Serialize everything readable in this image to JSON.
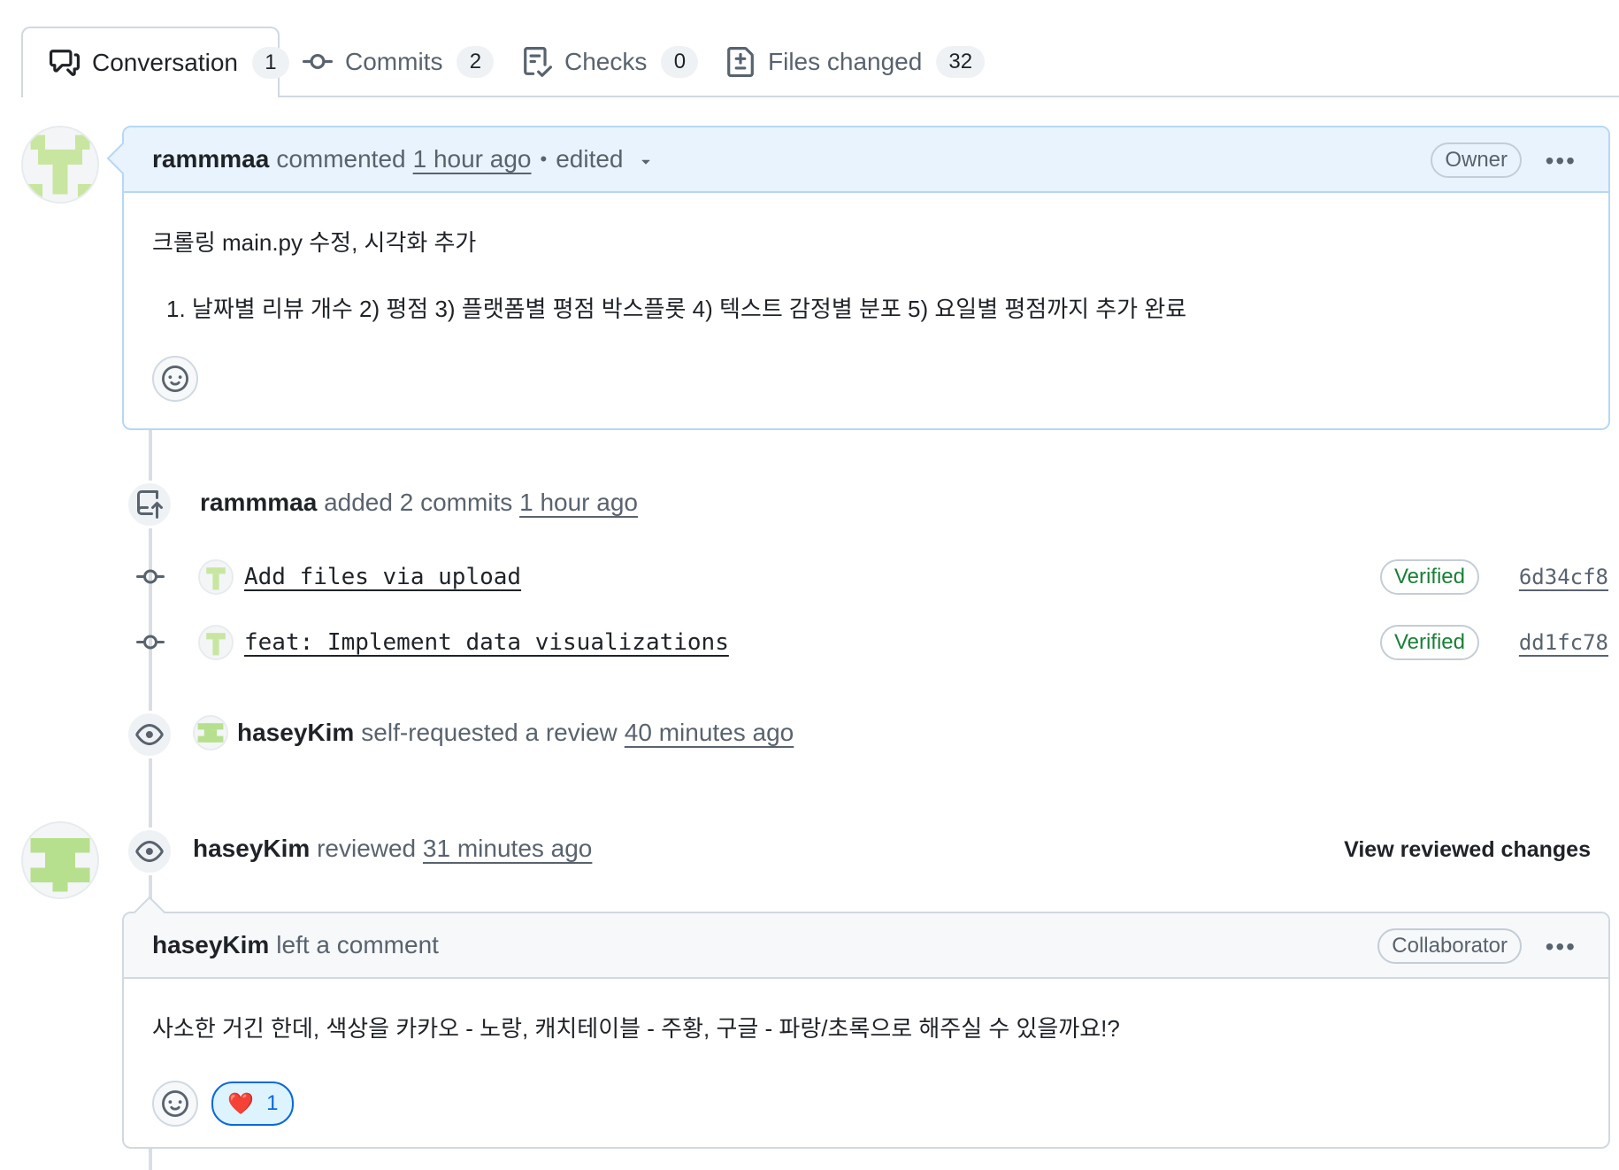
{
  "tabs": [
    {
      "label": "Conversation",
      "count": "1",
      "icon": "comment-discussion-icon",
      "selected": true
    },
    {
      "label": "Commits",
      "count": "2",
      "icon": "git-commit-icon",
      "selected": false
    },
    {
      "label": "Checks",
      "count": "0",
      "icon": "checklist-icon",
      "selected": false
    },
    {
      "label": "Files changed",
      "count": "32",
      "icon": "file-diff-icon",
      "selected": false
    }
  ],
  "comment1": {
    "author": "rammmaa",
    "action": "commented",
    "time": "1 hour ago",
    "separator": "•",
    "edited": "edited",
    "badge": "Owner",
    "menu": "•••",
    "body_line1": "크롤링 main.py 수정, 시각화 추가",
    "body_list_number": "1.",
    "body_list_item": "날짜별 리뷰 개수 2) 평점 3) 플랫폼별 평점 박스플롯 4) 텍스트 감정별 분포 5) 요일별 평점까지 추가 완료"
  },
  "commits_event": {
    "author": "rammmaa",
    "action": "added 2 commits",
    "time": "1 hour ago",
    "commits": [
      {
        "message": "Add files via upload",
        "verified": "Verified",
        "sha": "6d34cf8"
      },
      {
        "message": "feat: Implement data visualizations",
        "verified": "Verified",
        "sha": "dd1fc78"
      }
    ]
  },
  "review_request": {
    "author": "haseyKim",
    "action": "self-requested a review",
    "time": "40 minutes ago"
  },
  "review": {
    "author": "haseyKim",
    "action": "reviewed",
    "time": "31 minutes ago",
    "view_changes": "View reviewed changes"
  },
  "comment2": {
    "author": "haseyKim",
    "action": "left a comment",
    "badge": "Collaborator",
    "menu": "•••",
    "body": "사소한 거긴 한데, 색상을 카카오 - 노랑, 캐치테이블 - 주황, 구글 - 파랑/초록으로 해주실 수 있을까요!?",
    "reaction_emoji": "❤️",
    "reaction_count": "1"
  },
  "colors": {
    "link": "#0969da",
    "verified": "#1a7f37",
    "comment_header": "#e8f3fd",
    "avatar_green": "#b7e08e"
  }
}
